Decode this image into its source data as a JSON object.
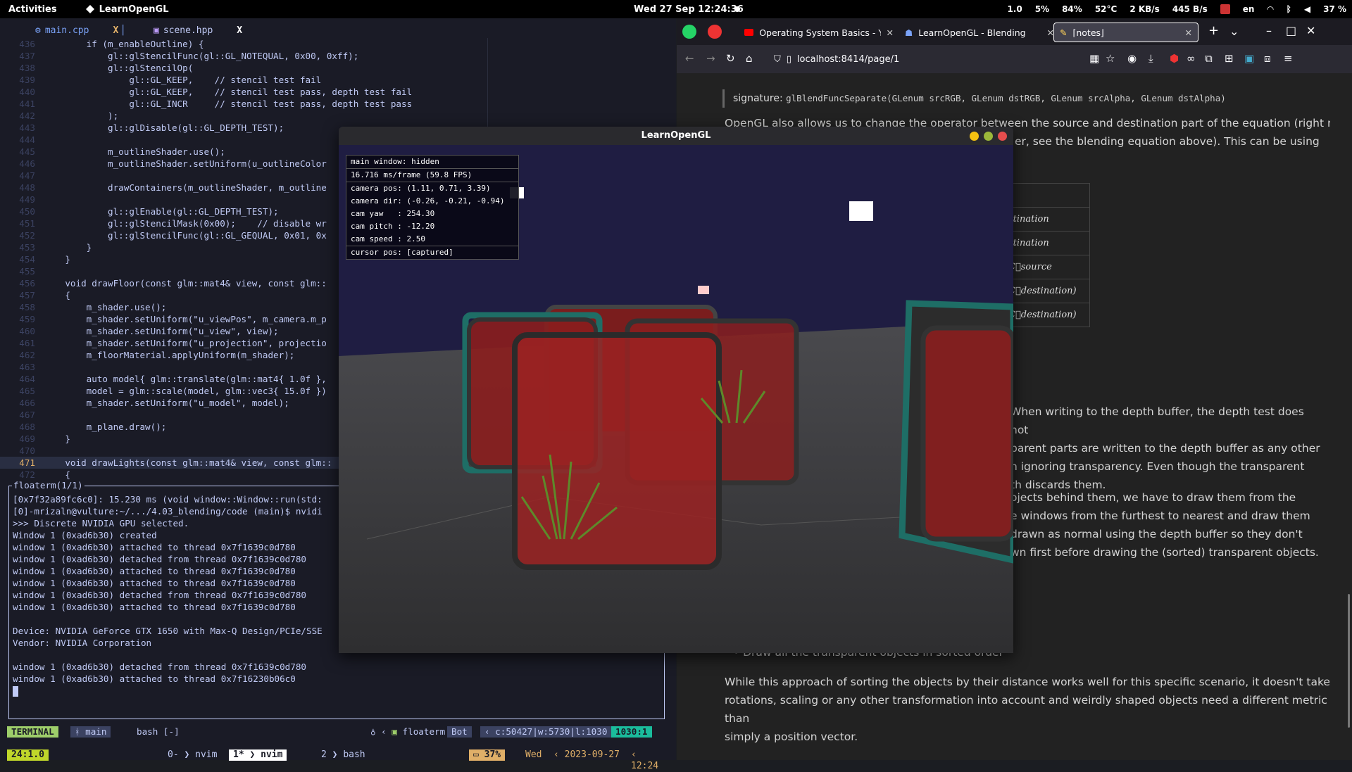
{
  "topbar": {
    "activities": "Activities",
    "app_name": "LearnOpenGL",
    "clock": "Wed 27 Sep  12:24:36",
    "stats": [
      "1.0",
      "5%",
      "84%",
      "52°C",
      "2 KB/s",
      "445 B/s",
      "en",
      "37 %"
    ]
  },
  "editor": {
    "tabs": [
      {
        "label": "main.cpp",
        "close": "X"
      },
      {
        "label": "scene.hpp",
        "close": "X"
      }
    ],
    "lines": [
      {
        "n": "436",
        "t": "        if (m_enableOutline) {"
      },
      {
        "n": "437",
        "t": "            gl::glStencilFunc(gl::GL_NOTEQUAL, 0x00, 0xff);"
      },
      {
        "n": "438",
        "t": "            gl::glStencilOp("
      },
      {
        "n": "439",
        "t": "                gl::GL_KEEP,    // stencil test fail"
      },
      {
        "n": "440",
        "t": "                gl::GL_KEEP,    // stencil test pass, depth test fail"
      },
      {
        "n": "441",
        "t": "                gl::GL_INCR     // stencil test pass, depth test pass"
      },
      {
        "n": "442",
        "t": "            );"
      },
      {
        "n": "443",
        "t": "            gl::glDisable(gl::GL_DEPTH_TEST);"
      },
      {
        "n": "444",
        "t": ""
      },
      {
        "n": "445",
        "t": "            m_outlineShader.use();"
      },
      {
        "n": "446",
        "t": "            m_outlineShader.setUniform(u_outlineColor"
      },
      {
        "n": "447",
        "t": ""
      },
      {
        "n": "448",
        "t": "            drawContainers(m_outlineShader, m_outline"
      },
      {
        "n": "449",
        "t": ""
      },
      {
        "n": "450",
        "t": "            gl::glEnable(gl::GL_DEPTH_TEST);"
      },
      {
        "n": "451",
        "t": "            gl::glStencilMask(0x00);    // disable wr"
      },
      {
        "n": "452",
        "t": "            gl::glStencilFunc(gl::GL_GEQUAL, 0x01, 0x"
      },
      {
        "n": "453",
        "t": "        }"
      },
      {
        "n": "454",
        "t": "    }"
      },
      {
        "n": "455",
        "t": ""
      },
      {
        "n": "456",
        "t": "    void drawFloor(const glm::mat4& view, const glm::"
      },
      {
        "n": "457",
        "t": "    {"
      },
      {
        "n": "458",
        "t": "        m_shader.use();"
      },
      {
        "n": "459",
        "t": "        m_shader.setUniform(\"u_viewPos\", m_camera.m_p"
      },
      {
        "n": "460",
        "t": "        m_shader.setUniform(\"u_view\", view);"
      },
      {
        "n": "461",
        "t": "        m_shader.setUniform(\"u_projection\", projectio"
      },
      {
        "n": "462",
        "t": "        m_floorMaterial.applyUniform(m_shader);"
      },
      {
        "n": "463",
        "t": ""
      },
      {
        "n": "464",
        "t": "        auto model{ glm::translate(glm::mat4{ 1.0f },"
      },
      {
        "n": "465",
        "t": "        model = glm::scale(model, glm::vec3{ 15.0f })"
      },
      {
        "n": "466",
        "t": "        m_shader.setUniform(\"u_model\", model);"
      },
      {
        "n": "467",
        "t": ""
      },
      {
        "n": "468",
        "t": "        m_plane.draw();"
      },
      {
        "n": "469",
        "t": "    }"
      },
      {
        "n": "470",
        "t": ""
      },
      {
        "n": "471",
        "t": "    void drawLights(const glm::mat4& view, const glm::"
      },
      {
        "n": "472",
        "t": "    {"
      }
    ],
    "current_line": "471"
  },
  "floaterm": {
    "title": "floaterm(1/1)",
    "lines": [
      "[0x7f32a89fc6c0]: 15.230 ms (void window::Window::run(std:",
      "[0]-mrizaln@vulture:~/.../4.03_blending/code (main)$ nvidi",
      ">>> Discrete NVIDIA GPU selected.",
      "Window 1 (0xad6b30) created",
      "window 1 (0xad6b30) attached to thread 0x7f1639c0d780",
      "window 1 (0xad6b30) detached from thread 0x7f1639c0d780",
      "window 1 (0xad6b30) attached to thread 0x7f1639c0d780",
      "window 1 (0xad6b30) attached to thread 0x7f1639c0d780",
      "window 1 (0xad6b30) detached from thread 0x7f1639c0d780",
      "window 1 (0xad6b30) attached to thread 0x7f1639c0d780",
      "",
      "Device: NVIDIA GeForce GTX 1650 with Max-Q Design/PCIe/SSE",
      "Vendor: NVIDIA Corporation",
      "",
      "window 1 (0xad6b30) detached from thread 0x7f1639c0d780",
      "window 1 (0xad6b30) attached to thread 0x7f16230b06c0"
    ]
  },
  "statusline": {
    "mode": "TERMINAL",
    "branch": "main",
    "shell": "bash [-]",
    "plugin": "floaterm",
    "pos": "Bot",
    "info": "c:50427|w:5730|l:1030",
    "linecol": "1030:1"
  },
  "tmux": {
    "session": "24:1.0",
    "windows": [
      {
        "idx": "0-",
        "name": "nvim"
      },
      {
        "idx": "1*",
        "name": "nvim"
      },
      {
        "idx": "2",
        "name": "bash"
      }
    ],
    "battery": "37%",
    "day": "Wed",
    "date": "2023-09-27",
    "time": "12:24"
  },
  "browser": {
    "tabs": [
      {
        "label": "Operating System Basics - Yo",
        "icon": "youtube-icon"
      },
      {
        "label": "LearnOpenGL - Blending",
        "icon": "learnopengl-icon"
      },
      {
        "label": "⌈notes⌋",
        "icon": "notes-icon"
      }
    ],
    "url": "localhost:8414/page/1",
    "signature_label": "signature:",
    "signature_code": "glBlendFuncSeparate(GLenum srcRGB, GLenum dstRGB, GLenum srcAlpha, GLenum dstAlpha)",
    "para1_a": "OpenGL also allows us to change the operator between the source and destination part of the equation (right now,",
    "para1_b": "er, see the blending equation above). This can be using",
    "eq_rows": [
      "",
      "stination",
      "stination",
      "C⃗source",
      "C⃗destination)",
      "C⃗destination)"
    ],
    "para2": [
      "When writing to the depth buffer, the depth test does not",
      "parent parts are written to the depth buffer as any other",
      "h ignoring transparency. Even though the transparent",
      "th discards them."
    ],
    "para3": [
      "ojects behind them, we have to draw them from the",
      "e windows from the furthest to nearest and draw them",
      "drawn as normal using the depth buffer so they don't",
      "wn first before drawing the (sorted) transparent objects."
    ],
    "bullet": "Draw all the transparent objects in sorted order",
    "para4": [
      "While this approach of sorting the objects by their distance works well for this specific scenario, it doesn't take",
      "rotations, scaling or any other transformation into account and weirdly shaped objects need a different metric than",
      "simply a position vector."
    ]
  },
  "glwindow": {
    "title": "LearnOpenGL",
    "overlay": {
      "main": "main window: hidden",
      "frame": "16.716 ms/frame (59.8 FPS)",
      "cam": [
        "camera pos: (1.11, 0.71, 3.39)",
        "camera dir: (-0.26, -0.21, -0.94)",
        "cam yaw   : 254.30",
        "cam pitch : -12.20",
        "cam speed : 2.50"
      ],
      "cursor": "cursor pos: [captured]"
    }
  },
  "colors": {
    "editor_bg": "#1a1b26",
    "accent": "#7aa2f7",
    "status_green": "#9ece6a",
    "floor": "#3a3a3c",
    "sky": "#1f1d42",
    "box_red": "#8b1e1e",
    "outline_teal": "#1e6e66"
  }
}
